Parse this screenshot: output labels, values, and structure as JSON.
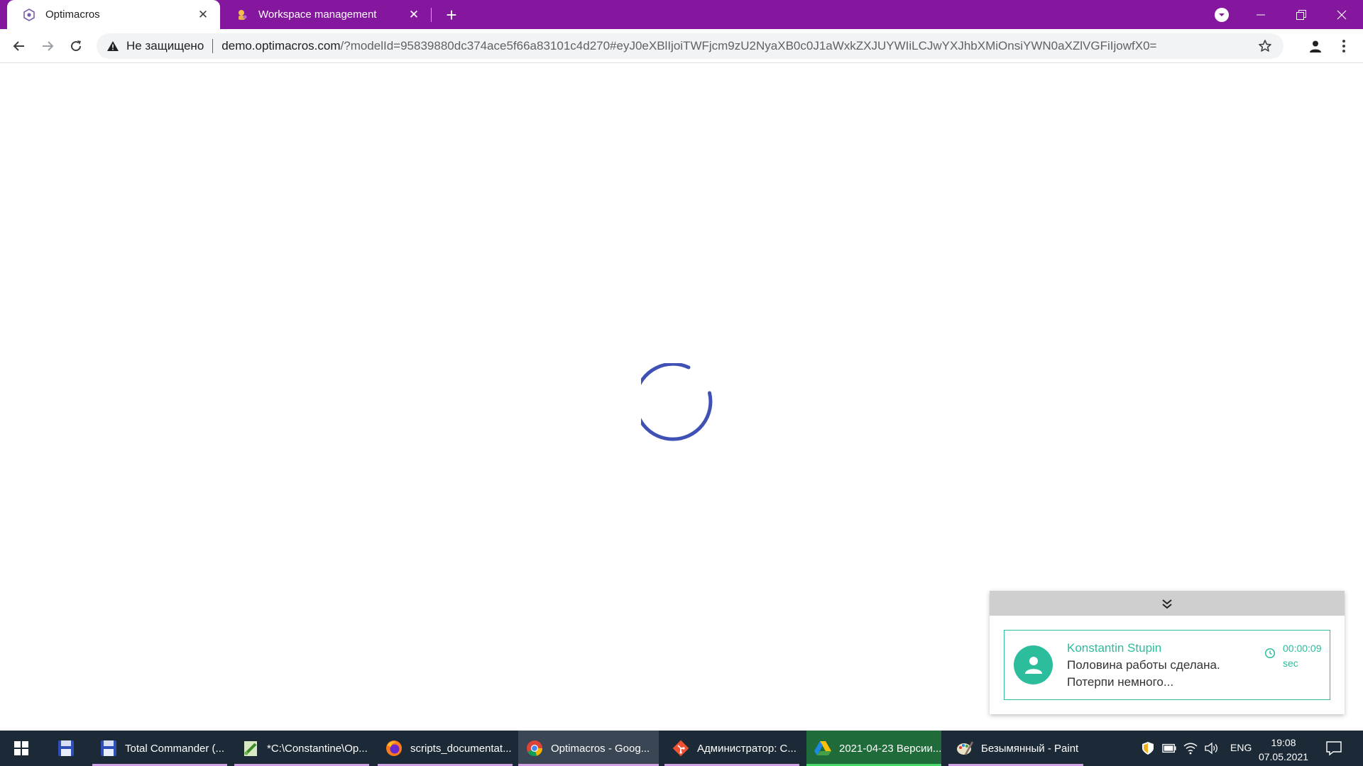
{
  "browser": {
    "tabs": [
      {
        "title": "Optimacros",
        "active": true
      },
      {
        "title": "Workspace management",
        "active": false
      }
    ],
    "security_label": "Не защищено",
    "url_host": "demo.optimacros.com",
    "url_rest": "/?modelId=95839880dc374ace5f66a83101c4d270#eyJ0eXBlIjoiTWFjcm9zU2NyaXB0c0J1aWxkZXJUYWIiLCJwYXJhbXMiOnsiYWN0aXZlVGFiIjowfX0=",
    "theme_color": "#85169e"
  },
  "content": {
    "spinner_color": "#3f51b5"
  },
  "notification": {
    "author": "Konstantin Stupin",
    "message_line1": "Половина работы сделана.",
    "message_line2": "Потерпи немного...",
    "time_value": "00:00:09",
    "time_unit": "sec",
    "accent_color": "#2bbd9c"
  },
  "taskbar": {
    "items": [
      {
        "label": "Total Commander (...",
        "icon": "floppy-disk-icon"
      },
      {
        "label": "*C:\\Constantine\\Op...",
        "icon": "notepad-plus-icon"
      },
      {
        "label": "scripts_documentat...",
        "icon": "firefox-icon"
      },
      {
        "label": "Optimacros - Goog...",
        "icon": "chrome-icon"
      },
      {
        "label": "Администратор: C...",
        "icon": "git-icon"
      },
      {
        "label": "2021-04-23 Версии...",
        "icon": "google-drive-icon"
      },
      {
        "label": "Безымянный - Paint",
        "icon": "paint-icon"
      }
    ],
    "language": "ENG",
    "time": "19:08",
    "date": "07.05.2021"
  }
}
